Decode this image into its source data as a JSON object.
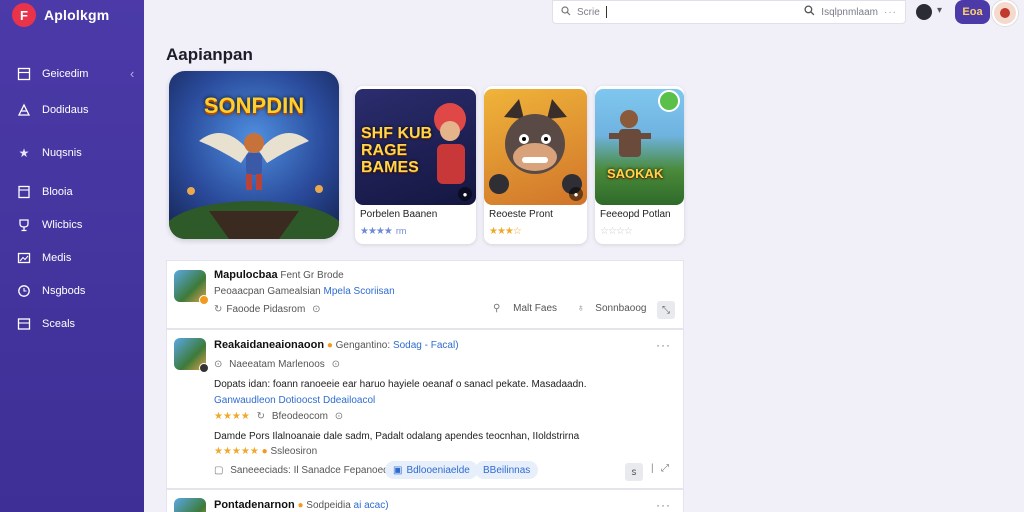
{
  "app": {
    "name": "Aplolkgm",
    "logo_letter": "F"
  },
  "sidebar": {
    "items": [
      {
        "label": "Geicedim",
        "icon": "home-icon"
      },
      {
        "label": "Dodidaus",
        "icon": "chart-icon"
      },
      {
        "label": "Nuqsnis",
        "icon": "star-icon"
      },
      {
        "label": "Blooia",
        "icon": "book-icon"
      },
      {
        "label": "Wlicbics",
        "icon": "trophy-icon"
      },
      {
        "label": "Medis",
        "icon": "image-icon"
      },
      {
        "label": "Nsgbods",
        "icon": "clock-icon"
      },
      {
        "label": "Sceals",
        "icon": "calendar-icon"
      }
    ]
  },
  "topbar": {
    "search_left": "Scrie",
    "search_placeholder": "",
    "search_right": "Isqlpnmlaam",
    "action_button": "Eoa"
  },
  "section_title": "Aapianpan",
  "hero": {
    "art_title": "SONPDIN"
  },
  "cards": [
    {
      "art_title": "SHF KUB RAGE BAMES",
      "name": "Porbelen Baanen",
      "stars": "★★★★",
      "count": "rm"
    },
    {
      "art_title": "",
      "name": "Reoeste Pront",
      "stars": "★★★☆",
      "count": ""
    },
    {
      "art_title": "SAOKAK",
      "name": "Feeeopd Potlan",
      "stars": "☆☆☆☆",
      "count": ""
    }
  ],
  "feed": [
    {
      "title": "Mapulocbaa",
      "title_tail": "Fent",
      "title_meta": "Gr Brode",
      "line2": "Peoaacpan Gamealsian",
      "line2_link": "Mpela Scoriisan",
      "line3": "Faoode Pidasrom",
      "action1": "Malt Faes",
      "action2": "Sonnbaoog"
    },
    {
      "title": "Reakaidaneaionaoon",
      "title_meta": "Gengantino:",
      "title_link": "Sodag - Facal)",
      "sub": "Naeeatam Marlenoos",
      "body": "Dopats idan: foann ranoeeie ear haruo hayiele oeanaf o sanacl pekate. Masadaadn.",
      "body_link1": "Ganwaudleon Dotioocst",
      "body_link2": "Ddeailoacol",
      "rating_stars": "★★★★",
      "rating_label": "Bfeodeocom",
      "body2": "Damde Pors Ilalnoanaie dale sadm, Padalt odalang apendes teocnhan, IIoldstrirna",
      "rating2_stars": "★★★★★",
      "rating2_label": "Ssleosiron",
      "footer_text": "Saneeeciads: Il Sanadce Fepanoed",
      "pill1": "Bdlooeniaelde",
      "pill2": "BBeilinnas"
    },
    {
      "title": "Pontadenarnon",
      "title_meta": "Sodpeidia",
      "title_link": "ai acac)"
    }
  ]
}
